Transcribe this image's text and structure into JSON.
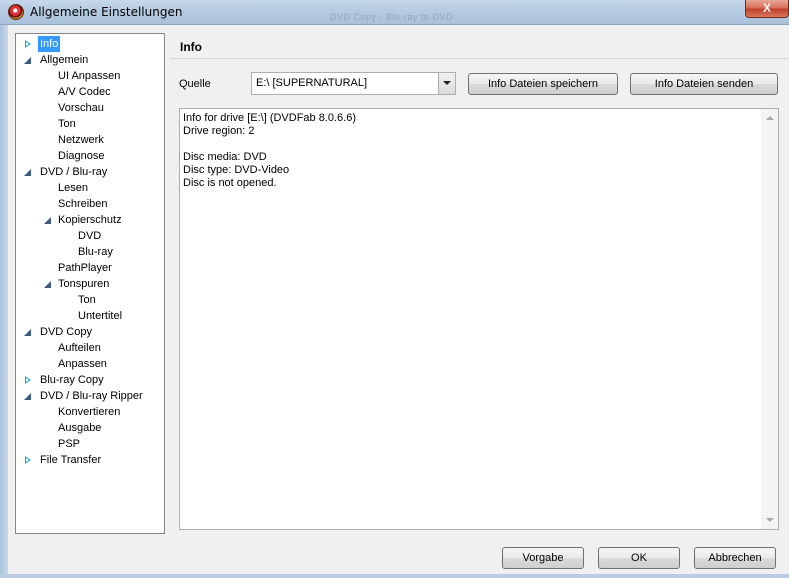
{
  "window": {
    "title": "Allgemeine Einstellungen",
    "ghost_title": "DVD Copy - Blu-ray to DVD",
    "close_label": "X"
  },
  "tree": {
    "items": [
      {
        "label": "Info",
        "expander": "right",
        "selected": true
      },
      {
        "label": "Allgemein",
        "expander": "down"
      },
      {
        "label": "UI Anpassen"
      },
      {
        "label": "A/V Codec"
      },
      {
        "label": "Vorschau"
      },
      {
        "label": "Ton"
      },
      {
        "label": "Netzwerk"
      },
      {
        "label": "Diagnose"
      },
      {
        "label": "DVD / Blu-ray",
        "expander": "down"
      },
      {
        "label": "Lesen"
      },
      {
        "label": "Schreiben"
      },
      {
        "label": "Kopierschutz",
        "expander": "down"
      },
      {
        "label": "DVD"
      },
      {
        "label": "Blu-ray"
      },
      {
        "label": "PathPlayer"
      },
      {
        "label": "Tonspuren",
        "expander": "down"
      },
      {
        "label": "Ton"
      },
      {
        "label": "Untertitel"
      },
      {
        "label": "DVD Copy",
        "expander": "down"
      },
      {
        "label": "Aufteilen"
      },
      {
        "label": "Anpassen"
      },
      {
        "label": "Blu-ray Copy",
        "expander": "right"
      },
      {
        "label": "DVD / Blu-ray Ripper",
        "expander": "down"
      },
      {
        "label": "Konvertieren"
      },
      {
        "label": "Ausgabe"
      },
      {
        "label": "PSP"
      },
      {
        "label": "File Transfer",
        "expander": "right"
      }
    ]
  },
  "panel": {
    "title": "Info",
    "source_label": "Quelle",
    "source_value": "E:\\ [SUPERNATURAL]",
    "save_button": "Info Dateien speichern",
    "send_button": "Info Dateien senden",
    "info_lines": [
      "Info for drive [E:\\] (DVDFab 8.0.6.6)",
      "Drive region: 2",
      "",
      "Disc media: DVD",
      "Disc type: DVD-Video",
      "Disc is not opened."
    ]
  },
  "footer": {
    "default_button": "Vorgabe",
    "ok_button": "OK",
    "cancel_button": "Abbrechen"
  },
  "colors": {
    "selection": "#3399ff",
    "expander_collapsed": "#26a0da",
    "expander_expanded": "#3c5a84"
  }
}
